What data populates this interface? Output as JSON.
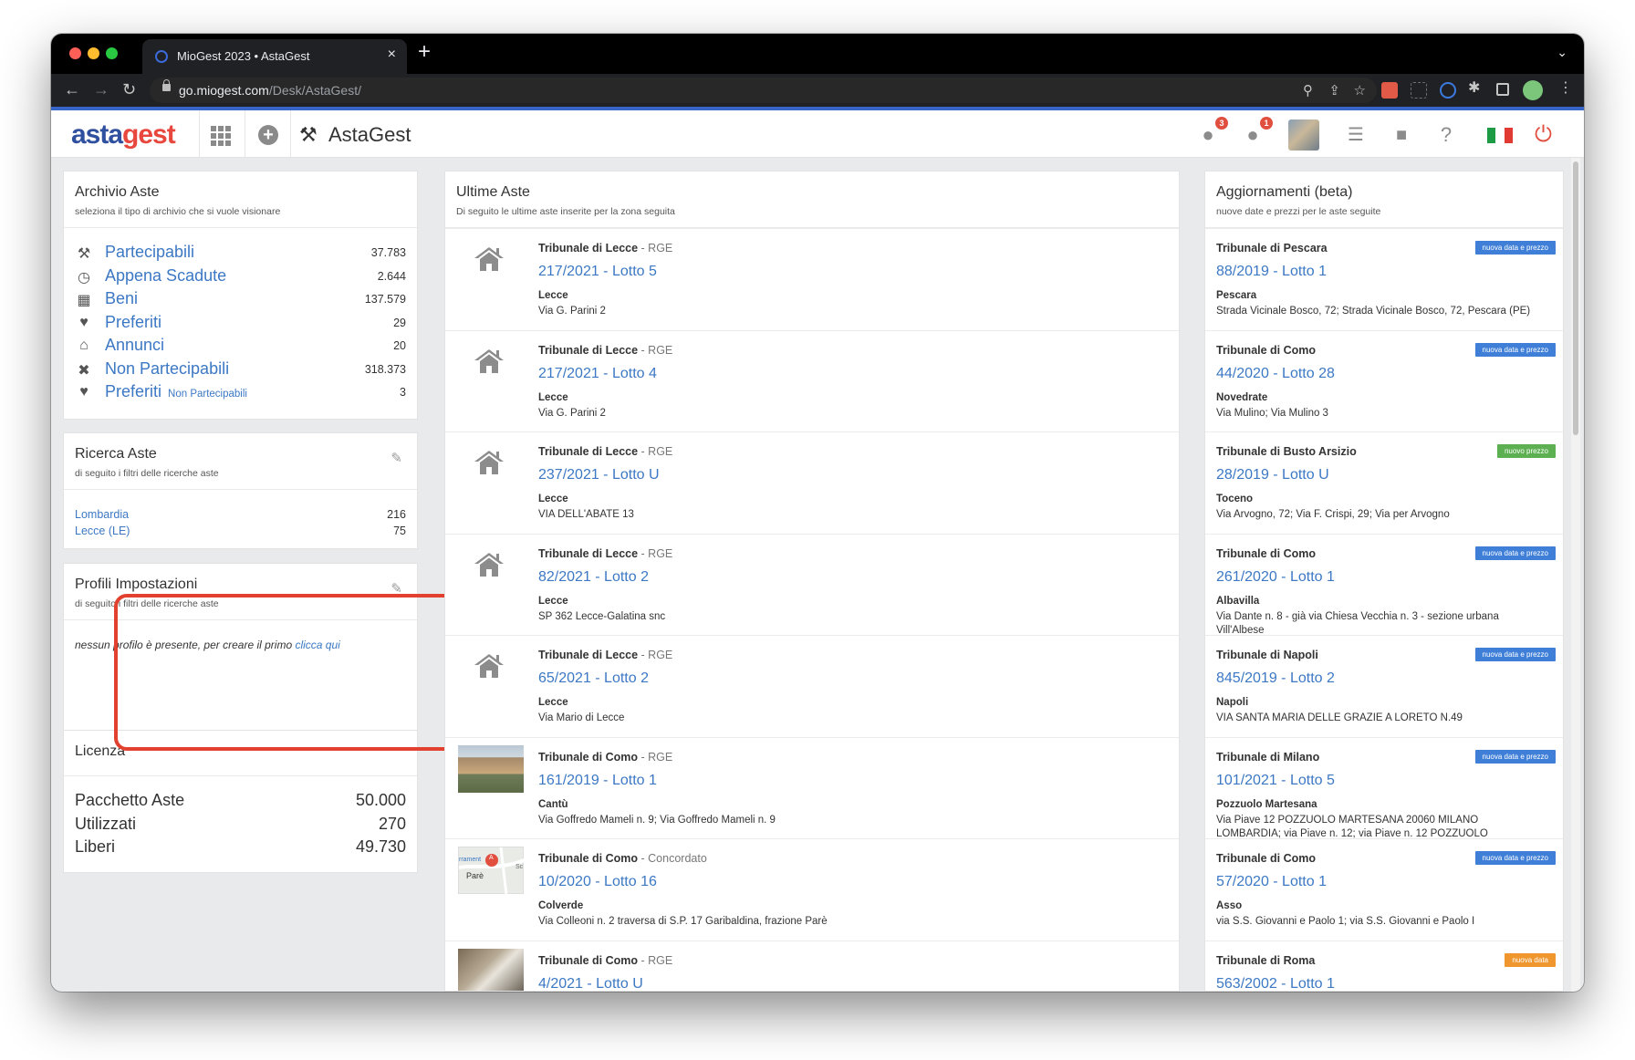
{
  "browser": {
    "tab_title": "MioGest 2023 • AstaGest",
    "tab_close": "×",
    "new_tab": "+",
    "tab_menu": "⌄",
    "url_host": "go.miogest.com",
    "url_path": "/Desk/AstaGest/",
    "icons": [
      "back-icon",
      "forward-icon",
      "reload-icon",
      "lock-icon",
      "zoom-icon",
      "share-icon",
      "star-icon",
      "extensions-icon",
      "sidepanel-icon",
      "profile-icon",
      "menu-icon"
    ],
    "colors": {
      "frame": "#000000",
      "toolbar": "#202124",
      "accent": "#3766c8"
    }
  },
  "header": {
    "logo_a": "asta",
    "logo_g": "gest",
    "app_title": "AstaGest",
    "alerts_count": "3",
    "messages_count": "1",
    "icons": [
      "apps-grid-icon",
      "add-icon",
      "gavel-icon",
      "alert-icon",
      "chat-icon",
      "settings-sliders-icon",
      "lock-icon",
      "help-icon",
      "italy-flag-icon",
      "power-icon"
    ],
    "colors": {
      "logo_primary": "#2f4f9f",
      "logo_secondary": "#e8473d",
      "badge": "#e14f3f"
    }
  },
  "archive": {
    "title": "Archivio Aste",
    "subtitle": "seleziona il tipo di archivio che si vuole visionare",
    "items": [
      {
        "icon": "gavel-icon",
        "label": "Partecipabili",
        "sub": "",
        "value": "37.783"
      },
      {
        "icon": "clock-icon",
        "label": "Appena Scadute",
        "sub": "",
        "value": "2.644"
      },
      {
        "icon": "building-icon",
        "label": "Beni",
        "sub": "",
        "value": "137.579"
      },
      {
        "icon": "heart-icon",
        "label": "Preferiti",
        "sub": "",
        "value": "29"
      },
      {
        "icon": "home-icon",
        "label": "Annunci",
        "sub": "",
        "value": "20"
      },
      {
        "icon": "x-icon",
        "label": "Non Partecipabili",
        "sub": "",
        "value": "318.373"
      },
      {
        "icon": "heart-icon",
        "label": "Preferiti",
        "sub": "Non Partecipabili",
        "value": "3"
      }
    ]
  },
  "search": {
    "title": "Ricerca Aste",
    "subtitle": "di seguito i filtri delle ricerche aste",
    "items": [
      {
        "label": "Lombardia",
        "value": "216"
      },
      {
        "label": "Lecce (LE)",
        "value": "75"
      }
    ]
  },
  "profiles": {
    "title": "Profili Impostazioni",
    "subtitle": "di seguito i filtri delle ricerche aste",
    "empty_text": "nessun profilo è presente, per creare il primo",
    "link": "clicca qui"
  },
  "license": {
    "title": "Licenza",
    "rows": [
      {
        "label": "Pacchetto Aste",
        "value": "50.000"
      },
      {
        "label": "Utilizzati",
        "value": "270"
      },
      {
        "label": "Liberi",
        "value": "49.730"
      }
    ]
  },
  "latest": {
    "title": "Ultime Aste",
    "subtitle": "Di seguito le ultime aste inserite per la zona seguita",
    "items": [
      {
        "court": "Tribunale di Lecce",
        "type": " - RGE",
        "lot": "217/2021 - Lotto 5",
        "city": "Lecce",
        "addr": "Via G. Parini 2",
        "thumb": "house"
      },
      {
        "court": "Tribunale di Lecce",
        "type": " - RGE",
        "lot": "217/2021 - Lotto 4",
        "city": "Lecce",
        "addr": "Via G. Parini 2",
        "thumb": "house"
      },
      {
        "court": "Tribunale di Lecce",
        "type": " - RGE",
        "lot": "237/2021 - Lotto U",
        "city": "Lecce",
        "addr": "VIA DELL'ABATE 13",
        "thumb": "house"
      },
      {
        "court": "Tribunale di Lecce",
        "type": " - RGE",
        "lot": "82/2021 - Lotto 2",
        "city": "Lecce",
        "addr": "SP 362 Lecce-Galatina snc",
        "thumb": "house"
      },
      {
        "court": "Tribunale di Lecce",
        "type": " - RGE",
        "lot": "65/2021 - Lotto 2",
        "city": "Lecce",
        "addr": "Via Mario di Lecce",
        "thumb": "house"
      },
      {
        "court": "Tribunale di Como",
        "type": " - RGE",
        "lot": "161/2019 - Lotto 1",
        "city": "Cantù",
        "addr": "Via Goffredo Mameli n. 9; Via Goffredo Mameli n. 9",
        "thumb": "photo"
      },
      {
        "court": "Tribunale di Como",
        "type": " - Concordato",
        "lot": "10/2020 - Lotto 16",
        "city": "Colverde",
        "addr": "Via Colleoni n. 2 traversa di S.P. 17 Garibaldina, frazione Parè",
        "thumb": "map"
      },
      {
        "court": "Tribunale di Como",
        "type": " - RGE",
        "lot": "4/2021 - Lotto U",
        "city": "",
        "addr": "",
        "thumb": "photo2"
      }
    ],
    "map_labels": {
      "place": "Parè",
      "pin": "A",
      "left": "rrament",
      "right": "Sc"
    }
  },
  "updates": {
    "title": "Aggiornamenti (beta)",
    "subtitle": "nuove date e prezzi per le aste seguite",
    "items": [
      {
        "court": "Tribunale di Pescara",
        "tag": "nuova data e prezzo",
        "tag_color": "#3f7fd8",
        "lot": "88/2019 - Lotto 1",
        "city": "Pescara",
        "addr": "Strada Vicinale Bosco, 72; Strada Vicinale Bosco, 72, Pescara (PE)"
      },
      {
        "court": "Tribunale di Como",
        "tag": "nuova data e prezzo",
        "tag_color": "#3f7fd8",
        "lot": "44/2020 - Lotto 28",
        "city": "Novedrate",
        "addr": "Via Mulino; Via Mulino 3"
      },
      {
        "court": "Tribunale di Busto Arsizio",
        "tag": "nuovo prezzo",
        "tag_color": "#5cb052",
        "lot": "28/2019 - Lotto U",
        "city": "Toceno",
        "addr": "Via Arvogno, 72; Via F. Crispi, 29; Via per Arvogno"
      },
      {
        "court": "Tribunale di Como",
        "tag": "nuova data e prezzo",
        "tag_color": "#3f7fd8",
        "lot": "261/2020 - Lotto 1",
        "city": "Albavilla",
        "addr": "Via Dante n. 8 - già via Chiesa Vecchia n. 3 - sezione urbana Vill'Albese"
      },
      {
        "court": "Tribunale di Napoli",
        "tag": "nuova data e prezzo",
        "tag_color": "#3f7fd8",
        "lot": "845/2019 - Lotto 2",
        "city": "Napoli",
        "addr": "VIA SANTA MARIA DELLE GRAZIE A LORETO N.49"
      },
      {
        "court": "Tribunale di Milano",
        "tag": "nuova data e prezzo",
        "tag_color": "#3f7fd8",
        "lot": "101/2021 - Lotto 5",
        "city": "Pozzuolo Martesana",
        "addr": "Via Piave 12 POZZUOLO MARTESANA 20060 MILANO LOMBARDIA; via Piave n. 12; via Piave n. 12 POZZUOLO"
      },
      {
        "court": "Tribunale di Como",
        "tag": "nuova data e prezzo",
        "tag_color": "#3f7fd8",
        "lot": "57/2020 - Lotto 1",
        "city": "Asso",
        "addr": "via S.S. Giovanni e Paolo 1; via S.S. Giovanni e Paolo I"
      },
      {
        "court": "Tribunale di Roma",
        "tag": "nuova data",
        "tag_color": "#f0962f",
        "lot": "563/2002 - Lotto 1",
        "city": "",
        "addr": ""
      }
    ]
  }
}
